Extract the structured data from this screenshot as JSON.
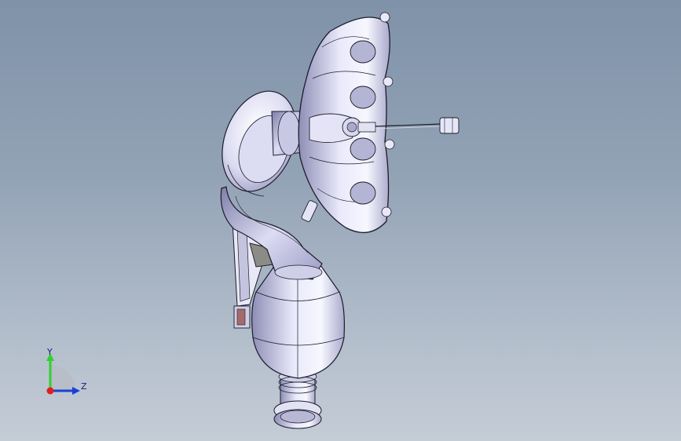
{
  "viewport": {
    "background_top": "#7f92a8",
    "background_bottom": "#c4ccd6"
  },
  "model": {
    "description_icon": "exhaust-manifold-assembly-icon",
    "edge_color": "#1c1c2a",
    "body_color": "#d6d6ee",
    "highlight_color": "#f6f6ff",
    "shadow_color": "#8c8cb0"
  },
  "triad": {
    "y_label": "Y",
    "z_label": "Z",
    "y_color": "#2fd12f",
    "z_color": "#1a3fd6",
    "x_color": "#e11d1d"
  }
}
